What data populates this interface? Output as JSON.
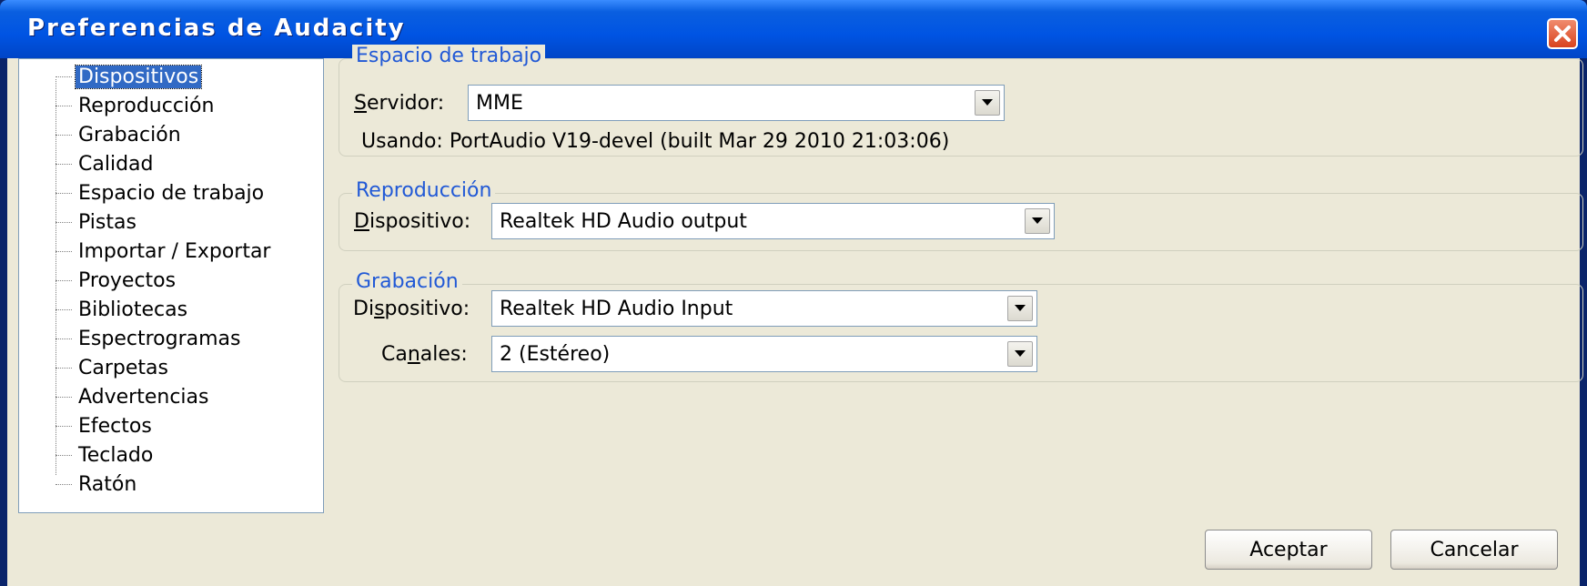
{
  "window": {
    "title": "Preferencias de Audacity"
  },
  "icons": {
    "close": "close-icon",
    "dropdown": "chevron-down-icon"
  },
  "colors": {
    "title_bar": "#0054e3",
    "group_title": "#2159d6",
    "selection": "#316ac5",
    "dialog_bg": "#ece9d8"
  },
  "sidebar": {
    "items": [
      {
        "label": "Dispositivos",
        "selected": true
      },
      {
        "label": "Reproducción"
      },
      {
        "label": "Grabación"
      },
      {
        "label": "Calidad"
      },
      {
        "label": "Espacio de trabajo"
      },
      {
        "label": "Pistas"
      },
      {
        "label": "Importar / Exportar"
      },
      {
        "label": "Proyectos"
      },
      {
        "label": "Bibliotecas"
      },
      {
        "label": "Espectrogramas"
      },
      {
        "label": "Carpetas"
      },
      {
        "label": "Advertencias"
      },
      {
        "label": "Efectos"
      },
      {
        "label": "Teclado"
      },
      {
        "label": "Ratón"
      }
    ]
  },
  "workspace": {
    "title": "Espacio de trabajo",
    "server_label_pre": "",
    "server_label_key": "S",
    "server_label_post": "ervidor:",
    "server_value": "MME",
    "using_text": "Usando: PortAudio V19-devel (built Mar 29 2010 21:03:06)"
  },
  "playback": {
    "title": "Reproducción",
    "device_label_pre": "",
    "device_label_key": "D",
    "device_label_post": "ispositivo:",
    "device_value": "Realtek HD Audio output"
  },
  "recording": {
    "title": "Grabación",
    "device_label_pre": "Di",
    "device_label_key": "s",
    "device_label_post": "positivo:",
    "device_value": "Realtek HD Audio Input",
    "channels_label_pre": "Ca",
    "channels_label_key": "n",
    "channels_label_post": "ales:",
    "channels_value": "2 (Estéreo)"
  },
  "buttons": {
    "ok": "Aceptar",
    "cancel": "Cancelar"
  }
}
